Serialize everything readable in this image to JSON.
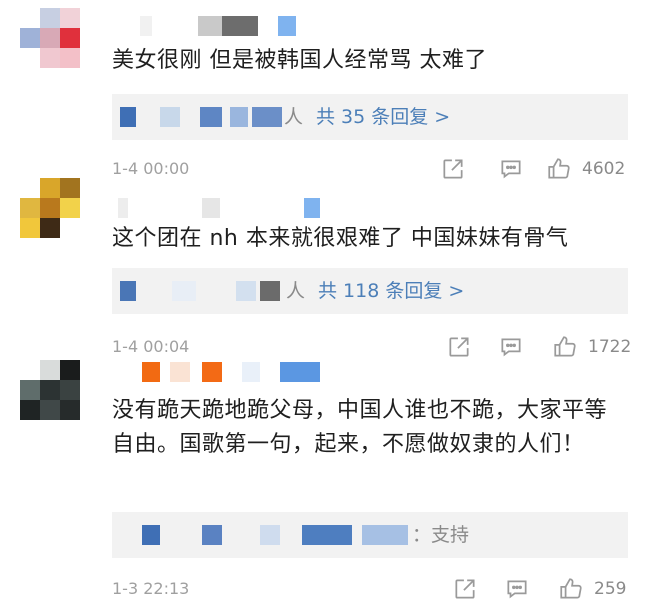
{
  "comments": [
    {
      "text": "美女很刚 但是被韩国人经常骂 太难了",
      "reply_lead": "人",
      "reply_link": "共 35 条回复 >",
      "time": "1-4 00:00",
      "likes": "4602"
    },
    {
      "text": "这个团在 nh 本来就很艰难了 中国妹妹有骨气",
      "reply_lead": "人",
      "reply_link": "共 118 条回复 >",
      "time": "1-4 00:04",
      "likes": "1722"
    },
    {
      "text": "没有跪天跪地跪父母，中国人谁也不跪，大家平等自由。国歌第一句，起来，不愿做奴隶的人们！",
      "reply_lead": "：支持",
      "reply_link": "",
      "time": "1-3 22:13",
      "likes": "259"
    }
  ],
  "icons": {
    "share": "share-icon",
    "comment": "comment-icon",
    "like": "thumbs-up-icon"
  },
  "colors": {
    "link": "#4c7fb8",
    "meta": "#a0a0a0",
    "reply_bg": "#f2f2f2"
  }
}
